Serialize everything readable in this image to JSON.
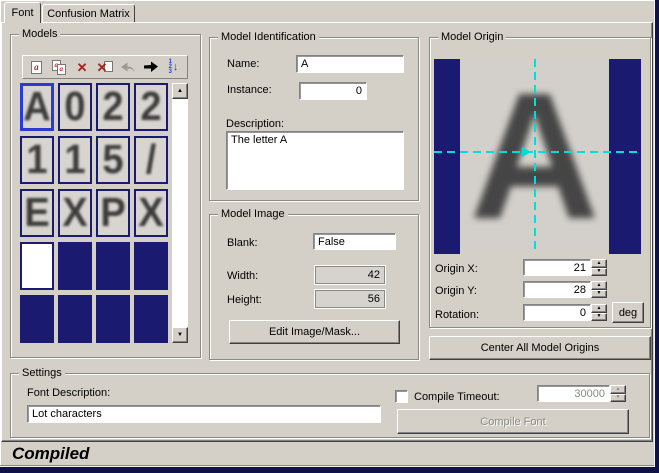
{
  "window": {
    "background": "#d4d0c8",
    "bottom_edge": "#10104a"
  },
  "tabs": {
    "font": "Font",
    "confusion_matrix": "Confusion Matrix"
  },
  "models": {
    "title": "Models",
    "icons": {
      "letter": "a",
      "delete_glyph": "✕",
      "sort_d1": "1",
      "sort_d2": "2",
      "sort_d3": "3",
      "sort_arrow": "↓",
      "scroll_up": "▲",
      "scroll_down": "▼"
    },
    "tiles": [
      {
        "char": "A",
        "selected": true
      },
      {
        "char": "0"
      },
      {
        "char": "2"
      },
      {
        "char": "2"
      },
      {
        "char": "1"
      },
      {
        "char": "1"
      },
      {
        "char": "5"
      },
      {
        "char": "/"
      },
      {
        "char": "E"
      },
      {
        "char": "X"
      },
      {
        "char": "P"
      },
      {
        "char": "X"
      },
      {
        "char": "",
        "blank": true
      },
      {
        "char": "",
        "empty": true
      },
      {
        "char": "",
        "empty": true
      },
      {
        "char": "",
        "empty": true
      },
      {
        "char": "",
        "empty": true
      },
      {
        "char": "",
        "empty": true
      },
      {
        "char": "",
        "empty": true
      },
      {
        "char": "",
        "empty": true
      }
    ]
  },
  "identification": {
    "title": "Model Identification",
    "name_label": "Name:",
    "name_value": "A",
    "instance_label": "Instance:",
    "instance_value": "0",
    "description_label": "Description:",
    "description_value": "The letter A"
  },
  "model_image": {
    "title": "Model Image",
    "blank_label": "Blank:",
    "blank_value": "False",
    "width_label": "Width:",
    "width_value": "42",
    "height_label": "Height:",
    "height_value": "56",
    "edit_button": "Edit Image/Mask..."
  },
  "model_origin": {
    "title": "Model Origin",
    "preview_char": "A",
    "origin_x_label": "Origin X:",
    "origin_x_value": "21",
    "origin_y_label": "Origin Y:",
    "origin_y_value": "28",
    "rotation_label": "Rotation:",
    "rotation_value": "0",
    "deg_button": "deg",
    "center_button": "Center All Model Origins",
    "crosshair_color": "#00dcdc"
  },
  "settings": {
    "title": "Settings",
    "font_description_label": "Font Description:",
    "font_description_value": "Lot characters",
    "compile_timeout_label": "Compile Timeout:",
    "compile_timeout_checked": false,
    "compile_timeout_value": "30000",
    "compile_button": "Compile Font"
  },
  "status": {
    "text": "Compiled"
  },
  "colors": {
    "navy_tile": "#1a1a70",
    "selected_tile_border": "#2a3ad2",
    "crosshair": "#00dcdc",
    "disabled_text": "#8a8a85",
    "background": "#d4d0c8"
  },
  "spin_glyphs": {
    "up": "▲",
    "down": "▼"
  }
}
